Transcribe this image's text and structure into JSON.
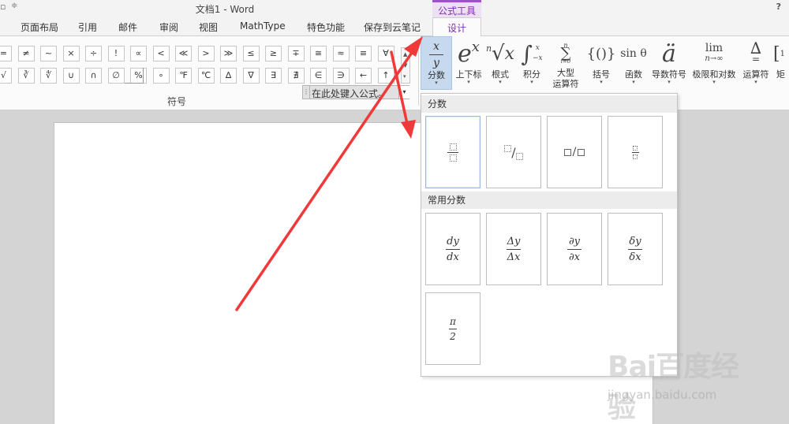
{
  "window": {
    "title": "文档1 - Word",
    "help_label": "?",
    "context_tab_group": "公式工具"
  },
  "qat": {
    "icon": "save-icon",
    "menu": "ribbon-options-icon"
  },
  "tabs": [
    "页面布局",
    "引用",
    "邮件",
    "审阅",
    "视图",
    "MathType",
    "特色功能",
    "保存到云笔记"
  ],
  "active_tab": "设计",
  "symbols": {
    "row1": [
      "=",
      "≠",
      "~",
      "×",
      "÷",
      "!",
      "∝",
      "<",
      "≪",
      ">",
      "≫",
      "≤",
      "≥",
      "∓",
      "≅",
      "≈",
      "≡",
      "∀"
    ],
    "row2": [
      "√",
      "∛",
      "∜",
      "∪",
      "∩",
      "∅",
      "%",
      "∘",
      "℉",
      "℃",
      "∆",
      "∇",
      "∃",
      "∄",
      "∈",
      "∋",
      "←",
      "↑"
    ],
    "group_label": "符号"
  },
  "equation_tools": [
    {
      "id": "fraction",
      "label": "分数"
    },
    {
      "id": "script",
      "label": "上下标"
    },
    {
      "id": "radical",
      "label": "根式"
    },
    {
      "id": "integral",
      "label": "积分"
    },
    {
      "id": "large_operator",
      "label": "大型",
      "label2": "运算符"
    },
    {
      "id": "bracket",
      "label": "括号"
    },
    {
      "id": "function",
      "label": "函数"
    },
    {
      "id": "accent",
      "label": "导数符号"
    },
    {
      "id": "limit_log",
      "label": "极限和对数"
    },
    {
      "id": "operator",
      "label": "运算符"
    },
    {
      "id": "matrix",
      "label": "矩"
    }
  ],
  "equation_placeholder": "在此处键入公式。",
  "fraction_panel": {
    "section1": "分数",
    "section2": "常用分数",
    "common": [
      {
        "num": "dy",
        "den": "dx"
      },
      {
        "num": "Δy",
        "den": "Δx"
      },
      {
        "num": "∂y",
        "den": "∂x"
      },
      {
        "num": "δy",
        "den": "δx"
      },
      {
        "num": "π",
        "den": "2"
      }
    ]
  },
  "watermark": {
    "logo": "Bai百度经验",
    "url": "jingyan.baidu.com"
  },
  "colors": {
    "accent_purple": "#8030b0",
    "selected_blue": "#c6d9ee",
    "arrow_red": "#f03a3a"
  }
}
